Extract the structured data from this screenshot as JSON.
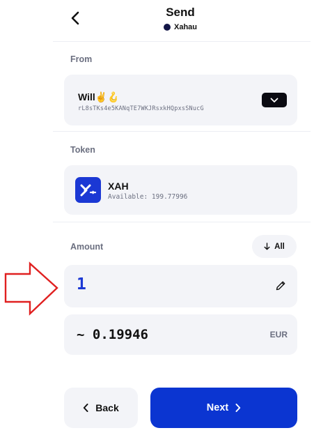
{
  "header": {
    "title": "Send",
    "network": "Xahau",
    "back_icon": "chevron-left-icon"
  },
  "from": {
    "label": "From",
    "account_name": "Will✌️🪝",
    "account_address": "rL8sTKs4e5KANqTE7WKJRsxkHQpxsSNucG",
    "toggle_icon": "chevron-down-icon"
  },
  "token": {
    "label": "Token",
    "symbol": "XAH",
    "available": "Available: 199.77996",
    "logo_icon": "xahau-logo-icon"
  },
  "amount": {
    "label": "Amount",
    "all_label": "All",
    "value": "1",
    "edit_icon": "pencil-icon",
    "fiat_value": "~ 0.19946",
    "fiat_currency": "EUR"
  },
  "footer": {
    "back_label": "Back",
    "next_label": "Next"
  },
  "colors": {
    "accent": "#0b35d1",
    "card_bg": "#f3f4f8",
    "annotation_arrow": "#e02020"
  }
}
